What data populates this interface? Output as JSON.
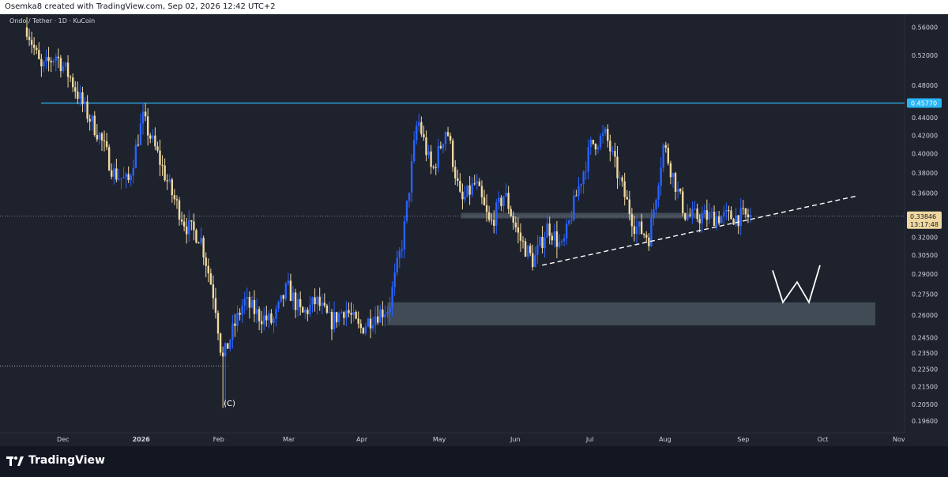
{
  "header": {
    "attribution": "Osemka8 created with TradingView.com, Sep 02, 2026 12:42 UTC+2",
    "symbol_line": "Ondo / Tether · 1D · KuCoin"
  },
  "footer": {
    "brand": "TradingView"
  },
  "colors": {
    "background": "#1e222d",
    "candle_up": "#2962ff",
    "candle_down": "#f0d9a0",
    "resistance_line": "#29b6f6",
    "zone": "#5d6e78",
    "text": "#d1d4dc"
  },
  "chart_data": {
    "type": "candlestick",
    "timeframe": "1D",
    "pair": "Ondo / Tether",
    "exchange": "KuCoin",
    "x_ticks": [
      "Dec",
      "2026",
      "Feb",
      "Mar",
      "Apr",
      "May",
      "Jun",
      "Jul",
      "Aug",
      "Sep",
      "Oct",
      "Nov"
    ],
    "y_ticks": [
      "0.56000",
      "0.52000",
      "0.48000",
      "0.44000",
      "0.42000",
      "0.40000",
      "0.38000",
      "0.36000",
      "0.32000",
      "0.30500",
      "0.29000",
      "0.27500",
      "0.26000",
      "0.24500",
      "0.23500",
      "0.22500",
      "0.21500",
      "0.20500",
      "0.19600"
    ],
    "y_ticks_values": [
      0.56,
      0.52,
      0.48,
      0.44,
      0.42,
      0.4,
      0.38,
      0.36,
      0.32,
      0.305,
      0.29,
      0.275,
      0.26,
      0.245,
      0.235,
      0.225,
      0.215,
      0.205,
      0.196
    ],
    "y_scale": "log",
    "ylim": [
      0.19,
      0.58
    ],
    "current_price": {
      "value": 0.33846,
      "label": "0.33846",
      "countdown": "13:17:48"
    },
    "resistance": {
      "value": 0.4577,
      "label": "0.45770"
    },
    "low_marker": {
      "value": 0.227
    },
    "annotation_low": {
      "label": "(C)",
      "value": 0.204
    },
    "price_path": [
      [
        0.0,
        0.56
      ],
      [
        0.02,
        0.5
      ],
      [
        0.04,
        0.52
      ],
      [
        0.06,
        0.49
      ],
      [
        0.08,
        0.45
      ],
      [
        0.1,
        0.42
      ],
      [
        0.12,
        0.38
      ],
      [
        0.14,
        0.37
      ],
      [
        0.16,
        0.44
      ],
      [
        0.18,
        0.4
      ],
      [
        0.2,
        0.36
      ],
      [
        0.22,
        0.33
      ],
      [
        0.24,
        0.32
      ],
      [
        0.26,
        0.27
      ],
      [
        0.27,
        0.23
      ],
      [
        0.285,
        0.25
      ],
      [
        0.3,
        0.27
      ],
      [
        0.32,
        0.26
      ],
      [
        0.34,
        0.255
      ],
      [
        0.36,
        0.28
      ],
      [
        0.38,
        0.26
      ],
      [
        0.4,
        0.27
      ],
      [
        0.42,
        0.255
      ],
      [
        0.44,
        0.265
      ],
      [
        0.46,
        0.25
      ],
      [
        0.48,
        0.26
      ],
      [
        0.5,
        0.265
      ],
      [
        0.52,
        0.32
      ],
      [
        0.54,
        0.44
      ],
      [
        0.56,
        0.38
      ],
      [
        0.58,
        0.43
      ],
      [
        0.6,
        0.35
      ],
      [
        0.62,
        0.37
      ],
      [
        0.64,
        0.33
      ],
      [
        0.66,
        0.36
      ],
      [
        0.68,
        0.32
      ],
      [
        0.7,
        0.3
      ],
      [
        0.72,
        0.33
      ],
      [
        0.74,
        0.31
      ],
      [
        0.76,
        0.36
      ],
      [
        0.78,
        0.41
      ],
      [
        0.8,
        0.42
      ],
      [
        0.82,
        0.37
      ],
      [
        0.84,
        0.33
      ],
      [
        0.86,
        0.32
      ],
      [
        0.88,
        0.41
      ],
      [
        0.9,
        0.36
      ],
      [
        0.91,
        0.34
      ],
      [
        0.92,
        0.338
      ]
    ],
    "zones": [
      {
        "x_start": 0.498,
        "x_end": 1.0,
        "low": 0.253,
        "high": 0.269
      },
      {
        "x_start": 0.6,
        "x_end": 0.945,
        "low": 0.3365,
        "high": 0.3415
      }
    ],
    "trendline": {
      "x_start": 0.712,
      "y_start": 0.297,
      "x_end": 0.917,
      "y_end": 0.338,
      "projection_x_end": 1.0,
      "projection_y_end": 0.357
    },
    "projected_shape": {
      "pattern": "W",
      "points": [
        [
          0.88,
          0.293
        ],
        [
          0.895,
          0.269
        ],
        [
          0.91,
          0.284
        ],
        [
          0.925,
          0.269
        ],
        [
          0.94,
          0.297
        ]
      ]
    }
  }
}
